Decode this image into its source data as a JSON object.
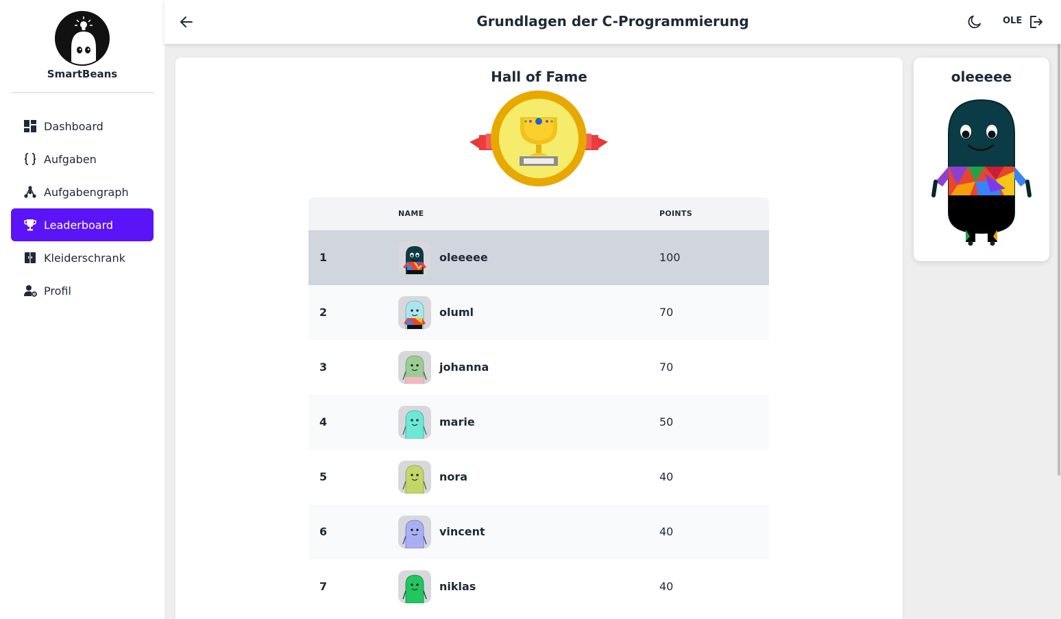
{
  "brand": {
    "name": "SmartBeans"
  },
  "sidebar": {
    "items": [
      {
        "label": "Dashboard",
        "icon": "dashboard-icon",
        "active": false
      },
      {
        "label": "Aufgaben",
        "icon": "braces-icon",
        "active": false
      },
      {
        "label": "Aufgabengraph",
        "icon": "graph-icon",
        "active": false
      },
      {
        "label": "Leaderboard",
        "icon": "trophy-icon",
        "active": true
      },
      {
        "label": "Kleiderschrank",
        "icon": "wardrobe-icon",
        "active": false
      },
      {
        "label": "Profil",
        "icon": "user-settings-icon",
        "active": false
      }
    ]
  },
  "header": {
    "title": "Grundlagen der C-Programmierung",
    "user": "OLE"
  },
  "main": {
    "title": "Hall of Fame",
    "table": {
      "columns": {
        "name": "NAME",
        "points": "POINTS"
      },
      "rows": [
        {
          "rank": "1",
          "name": "oleeeee",
          "points": "100",
          "color": "#0b3b44"
        },
        {
          "rank": "2",
          "name": "oluml",
          "points": "70",
          "color": "#a9e6ee"
        },
        {
          "rank": "3",
          "name": "johanna",
          "points": "70",
          "color": "#9ccc95"
        },
        {
          "rank": "4",
          "name": "marie",
          "points": "50",
          "color": "#6ee8d6"
        },
        {
          "rank": "5",
          "name": "nora",
          "points": "40",
          "color": "#c3d66a"
        },
        {
          "rank": "6",
          "name": "vincent",
          "points": "40",
          "color": "#a9b0f2"
        },
        {
          "rank": "7",
          "name": "niklas",
          "points": "40",
          "color": "#22c55e"
        }
      ]
    }
  },
  "profile": {
    "name": "oleeeee"
  },
  "colors": {
    "accent": "#5b13f7",
    "highlight_row": "#d1d5de"
  }
}
